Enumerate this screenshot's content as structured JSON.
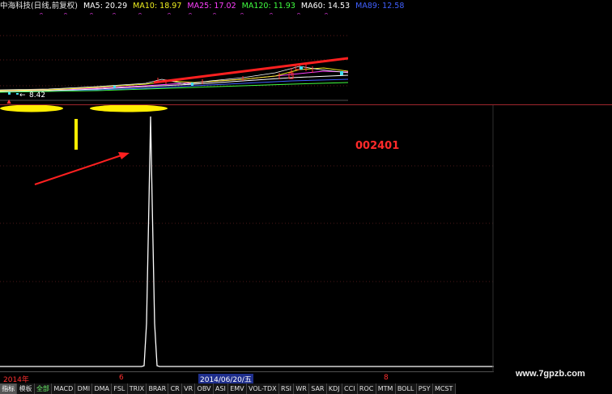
{
  "colors": {
    "background": "#000000",
    "divider": "#a0262d",
    "annotation_red": "#ff2020",
    "highlight_yellow": "#ffee00",
    "ma5": "#ffffff",
    "ma10": "#f0f020",
    "ma25": "#ff40ff",
    "ma120": "#40ff40",
    "ma60": "#ffffff",
    "ma_extra": "#4060ff"
  },
  "header": {
    "title": "中海科技(日线,前复权)",
    "ma_items": [
      {
        "label": "MA5: 20.29",
        "color": "#ffffff"
      },
      {
        "label": "MA10: 18.97",
        "color": "#f0f020"
      },
      {
        "label": "MA25: 17.02",
        "color": "#ff40ff"
      },
      {
        "label": "MA120: 11.93",
        "color": "#40ff40"
      },
      {
        "label": "MA60: 14.53",
        "color": "#ffffff"
      },
      {
        "label": "MA89: 12.58",
        "color": "#4060ff"
      }
    ]
  },
  "price_panel": {
    "low_label": "8.42"
  },
  "annotation": {
    "stock_code": "002401"
  },
  "time_axis": {
    "year_label": "2014年",
    "month_6": "6",
    "cursor_date": "2014/06/20/五",
    "month_8": "8"
  },
  "indicator_tabs": [
    {
      "label": "指标",
      "style": "hl"
    },
    {
      "label": "模板",
      "style": ""
    },
    {
      "label": "全部",
      "style": "green"
    },
    {
      "label": "MACD",
      "style": ""
    },
    {
      "label": "DMI",
      "style": ""
    },
    {
      "label": "DMA",
      "style": ""
    },
    {
      "label": "FSL",
      "style": ""
    },
    {
      "label": "TRIX",
      "style": ""
    },
    {
      "label": "BRAR",
      "style": ""
    },
    {
      "label": "CR",
      "style": ""
    },
    {
      "label": "VR",
      "style": ""
    },
    {
      "label": "OBV",
      "style": ""
    },
    {
      "label": "ASI",
      "style": ""
    },
    {
      "label": "EMV",
      "style": ""
    },
    {
      "label": "VOL-TDX",
      "style": ""
    },
    {
      "label": "RSI",
      "style": ""
    },
    {
      "label": "WR",
      "style": ""
    },
    {
      "label": "SAR",
      "style": ""
    },
    {
      "label": "KDJ",
      "style": ""
    },
    {
      "label": "CCI",
      "style": ""
    },
    {
      "label": "ROC",
      "style": ""
    },
    {
      "label": "MTM",
      "style": ""
    },
    {
      "label": "BOLL",
      "style": ""
    },
    {
      "label": "PSY",
      "style": ""
    },
    {
      "label": "MCST",
      "style": ""
    }
  ],
  "watermark": "www.7gpzb.com"
}
